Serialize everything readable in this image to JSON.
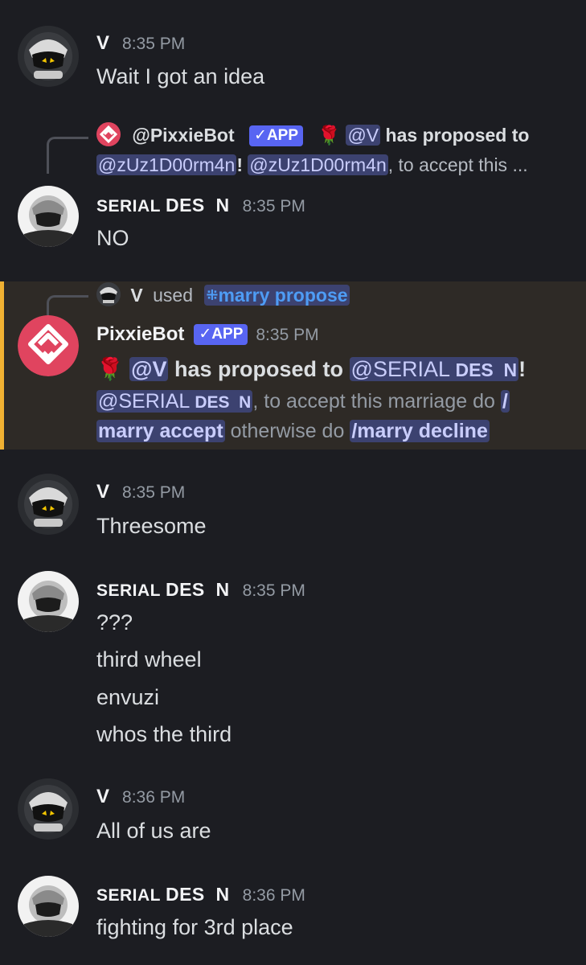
{
  "messages": [
    {
      "author": "V",
      "time": "8:35 PM",
      "lines": [
        "Wait I got an idea"
      ]
    },
    {
      "reply": {
        "author": "@PixxieBot",
        "badge": "✓APP",
        "emoji": "🌹",
        "mention1": "@V",
        "text1": " has proposed to",
        "mention2": "@zUz1D00rm4n",
        "bang": "!",
        "mention3": "@zUz1D00rm4n",
        "text2": ", to accept this ..."
      },
      "author_a": "SERIAL ",
      "author_b": "DES",
      "author_c": "  N",
      "time": "8:35 PM",
      "lines": [
        "NO"
      ]
    },
    {
      "used": {
        "author": "V",
        "word": "used",
        "command": "marry propose"
      },
      "author": "PixxieBot",
      "badge": "✓APP",
      "time": "8:35 PM",
      "emoji": "🌹",
      "mention_v": "@V",
      "proposed_text": "has proposed to",
      "mention_target_a": "@SERIAL ",
      "mention_target_b": "DES",
      "mention_target_c": "  N",
      "bang": "!",
      "line2_text": ", to accept this marriage do",
      "slash": "/",
      "accept_cmd": "marry accept",
      "otherwise": "otherwise do",
      "decline_cmd": "/marry decline"
    },
    {
      "author": "V",
      "time": "8:35 PM",
      "lines": [
        "Threesome"
      ]
    },
    {
      "author_a": "SERIAL ",
      "author_b": "DES",
      "author_c": "  N",
      "time": "8:35 PM",
      "lines": [
        "???",
        "third wheel",
        "envuzi",
        "whos the third"
      ]
    },
    {
      "author": "V",
      "time": "8:36 PM",
      "lines": [
        "All of us are"
      ]
    },
    {
      "author_a": "SERIAL ",
      "author_b": "DES",
      "author_c": "  N",
      "time": "8:36 PM",
      "lines": [
        "fighting for 3rd place"
      ]
    }
  ],
  "colors": {
    "background": "#1c1d22",
    "mention_bg": "#3c4270",
    "highlight_bar": "#f0b132",
    "app_badge": "#5865f2",
    "bot_avatar": "#e0445f"
  }
}
